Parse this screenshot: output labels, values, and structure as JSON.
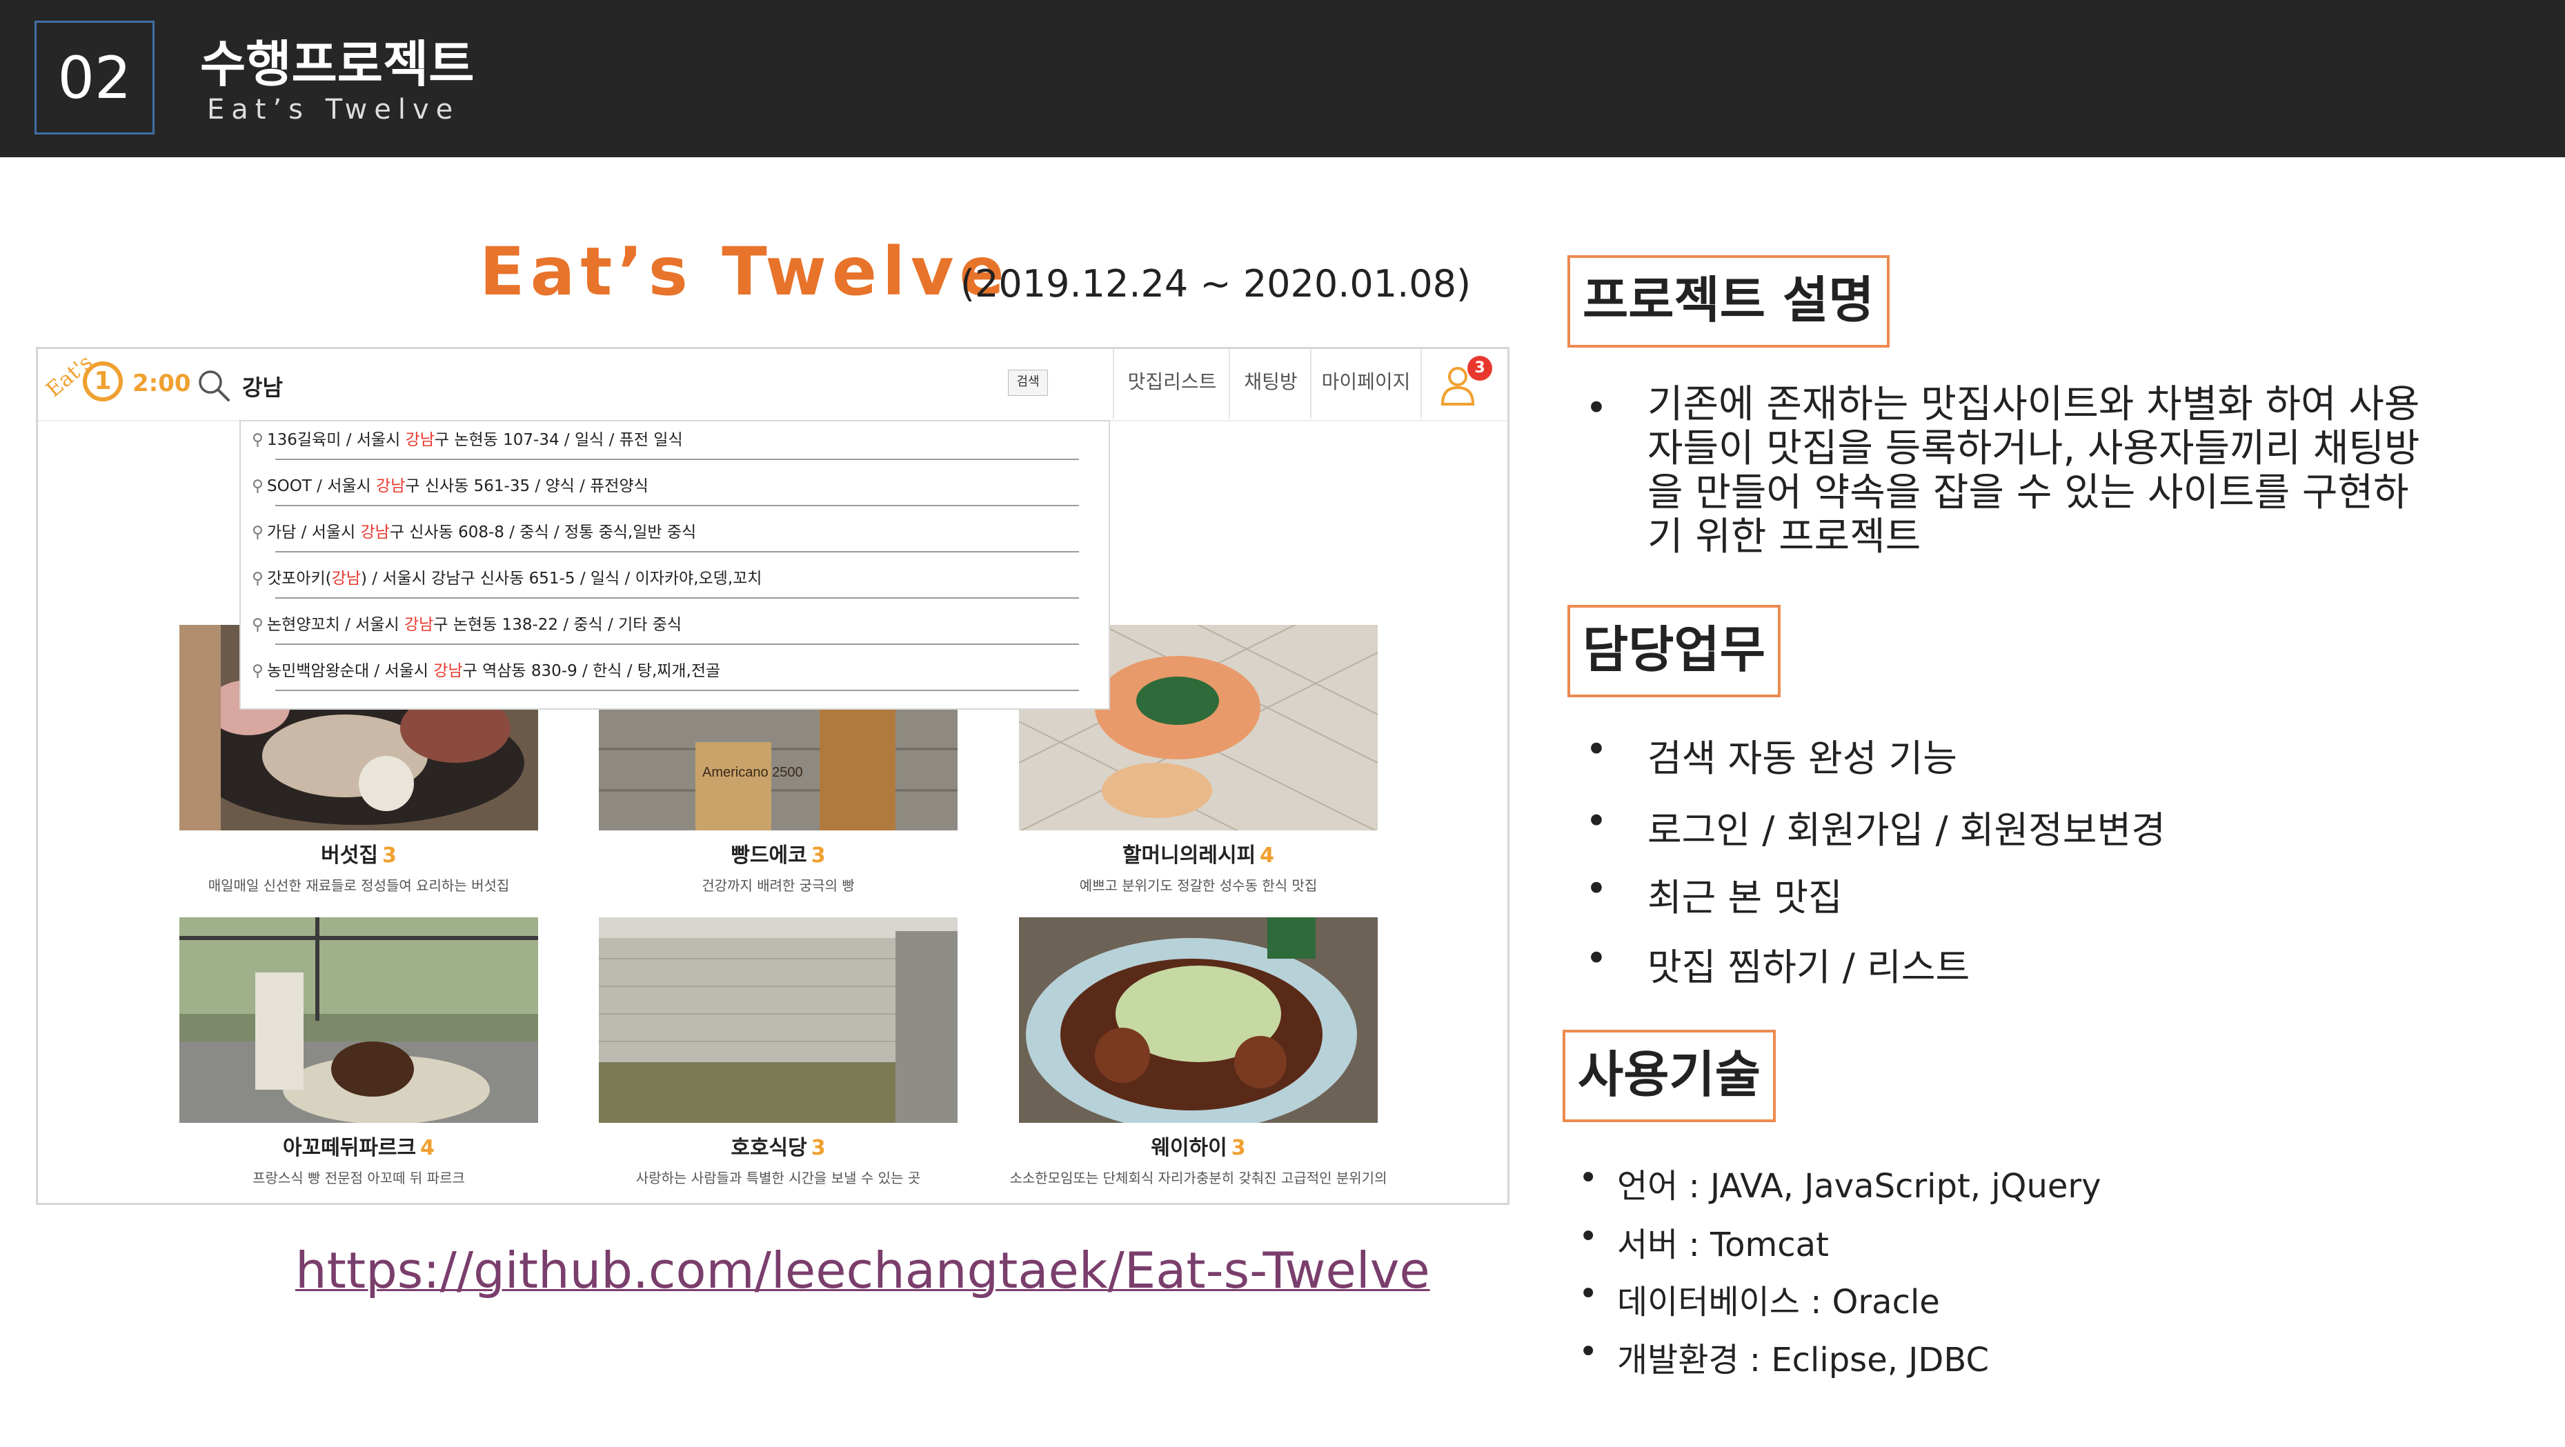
{
  "header": {
    "number": "02",
    "title": "수행프로젝트",
    "subtitle": "Eat’s Twelve"
  },
  "project": {
    "title": "Eat’s Twelve",
    "period": "(2019.12.24 ~ 2020.01.08)",
    "github": "https://github.com/leechangtaek/Eat-s-Twelve"
  },
  "screenshot": {
    "logo_text": "Eat's",
    "logo_digit": "1",
    "logo_time": "2:00",
    "search_value": "강남",
    "search_button": "검색",
    "nav": [
      "맛집리스트",
      "채팅방",
      "마이페이지"
    ],
    "cart_badge": "3",
    "suggestions": [
      {
        "pre": "136길육미  /  서울시 ",
        "hl": "강남",
        "post": "구 논현동 107-34  /  일식  /  퓨전 일식"
      },
      {
        "pre": "SOOT  /  서울시 ",
        "hl": "강남",
        "post": "구 신사동 561-35  /  양식  /  퓨전양식"
      },
      {
        "pre": "가담  /  서울시 ",
        "hl": "강남",
        "post": "구 신사동 608-8  /  중식  /  정통 중식,일반 중식"
      },
      {
        "pre": "갓포아키(",
        "hl": "강남",
        "post": ")  /  서울시 강남구 신사동 651-5  /  일식  /  이자카야,오뎅,꼬치"
      },
      {
        "pre": "논현양꼬치  /  서울시 ",
        "hl": "강남",
        "post": "구 논현동 138-22  /  중식  /  기타 중식"
      },
      {
        "pre": "농민백암왕순대  /  서울시 ",
        "hl": "강남",
        "post": "구 역삼동 830-9  /  한식  /  탕,찌개,전골"
      }
    ],
    "cards": [
      {
        "name": "버섯집",
        "score": "3",
        "desc": "매일매일 신선한 재료들로 정성들여 요리하는 버섯집"
      },
      {
        "name": "빵드에코",
        "score": "3",
        "desc": "건강까지 배려한 궁극의 빵"
      },
      {
        "name": "할머니의레시피",
        "score": "4",
        "desc": "예쁘고 분위기도 정갈한 성수동 한식 맛집"
      },
      {
        "name": "아꼬떼뒤파르크",
        "score": "4",
        "desc": "프랑스식 빵 전문점 아꼬떼 뒤 파르크"
      },
      {
        "name": "호호식당",
        "score": "3",
        "desc": "사랑하는 사람들과 특별한 시간을 보낼 수 있는 곳"
      },
      {
        "name": "웨이하이",
        "score": "3",
        "desc": "소소한모임또는 단체회식 자리가충분히 갖춰진 고급적인 분위기의"
      }
    ],
    "sign_text": "Americano 2500"
  },
  "right": {
    "desc_title": "프로젝트 설명",
    "desc_lines": [
      "기존에 존재하는 맛집사이트와 차별화 하여 사용",
      "자들이 맛집을 등록하거나, 사용자들끼리 채팅방",
      "을 만들어 약속을 잡을 수 있는 사이트를 구현하",
      "기 위한 프로젝트"
    ],
    "duty_title": "담당업무",
    "duties": [
      "검색 자동 완성 기능",
      "로그인 / 회원가입 / 회원정보변경",
      "최근 본 맛집",
      "맛집 찜하기 / 리스트"
    ],
    "tech_title": "사용기술",
    "techs": [
      "언어 : JAVA, JavaScript, jQuery",
      "서버 : Tomcat",
      "데이터베이스 : Oracle",
      "개발환경 : Eclipse, JDBC"
    ],
    "bullet": "•"
  },
  "colors": {
    "accent": "#e8732a",
    "header_bg": "#262626",
    "highlight": "#e8382e",
    "score": "#f0a030"
  }
}
